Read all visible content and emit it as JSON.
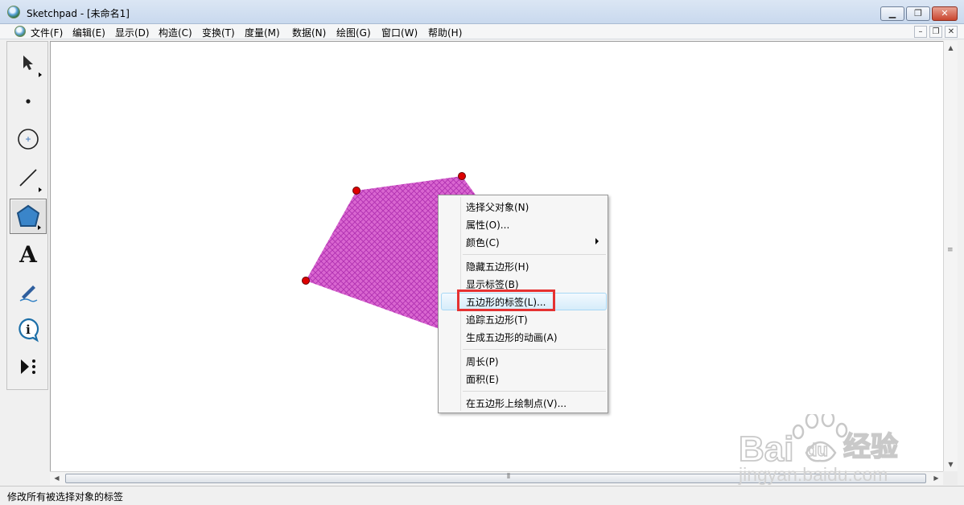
{
  "window": {
    "title": "Sketchpad  - [未命名1]",
    "minimize_label": "▁",
    "restore_label": "❐",
    "close_label": "✕"
  },
  "menu": {
    "items": [
      {
        "label": "文件(F)"
      },
      {
        "label": "编辑(E)"
      },
      {
        "label": "显示(D)"
      },
      {
        "label": "构造(C)"
      },
      {
        "label": "变换(T)"
      },
      {
        "label": "度量(M)"
      },
      {
        "label": "数据(N)"
      },
      {
        "label": "绘图(G)"
      },
      {
        "label": "窗口(W)"
      },
      {
        "label": "帮助(H)"
      }
    ],
    "mdi_minimize": "–",
    "mdi_restore": "❐",
    "mdi_close": "✕"
  },
  "toolbar": {
    "tools": [
      {
        "name": "arrow-select-icon"
      },
      {
        "name": "point-tool-icon"
      },
      {
        "name": "compass-tool-icon"
      },
      {
        "name": "straightedge-tool-icon"
      },
      {
        "name": "polygon-tool-icon",
        "selected": true
      },
      {
        "name": "text-tool-icon",
        "label": "A"
      },
      {
        "name": "marker-tool-icon"
      },
      {
        "name": "information-tool-icon",
        "label": "i"
      },
      {
        "name": "custom-tool-icon"
      }
    ]
  },
  "canvas": {
    "polygon": {
      "fill_color": "#d966d0",
      "hatch_color": "#b030b0",
      "vertex_color": "#dd0000"
    }
  },
  "context_menu": {
    "items": [
      {
        "label": "选择父对象(N)"
      },
      {
        "label": "属性(O)..."
      },
      {
        "label": "颜色(C)",
        "has_submenu": true
      },
      {
        "label": "隐藏五边形(H)"
      },
      {
        "label": "显示标签(B)"
      },
      {
        "label": "五边形的标签(L)...",
        "highlighted": true
      },
      {
        "label": "追踪五边形(T)"
      },
      {
        "label": "生成五边形的动画(A)"
      },
      {
        "label": "周长(P)"
      },
      {
        "label": "面积(E)"
      },
      {
        "label": "在五边形上绘制点(V)..."
      }
    ],
    "highlight_color": "#e53232"
  },
  "statusbar": {
    "text": "修改所有被选择对象的标签"
  },
  "watermark": {
    "brand": "Bai",
    "brand_du": "du",
    "service": "经验",
    "url": "jingyan.baidu.com"
  }
}
